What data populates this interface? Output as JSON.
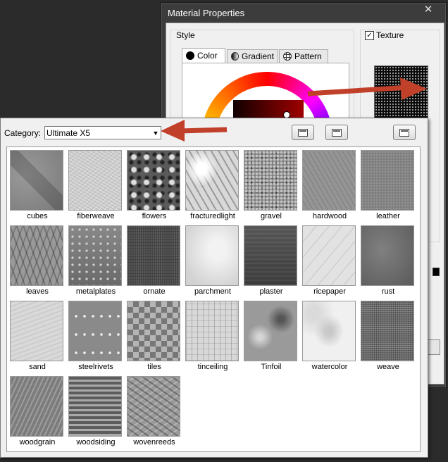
{
  "material_window": {
    "title": "Material Properties",
    "close_glyph": "✕",
    "style_group_label": "Style",
    "tabs": [
      {
        "label": "Color"
      },
      {
        "label": "Gradient"
      },
      {
        "label": "Pattern"
      }
    ],
    "texture_checkbox_label": "Texture",
    "texture_checked": true,
    "check_glyph": "✓"
  },
  "picker": {
    "category_label": "Category:",
    "category_value": "Ultimate X5",
    "dropdown_glyph": "▼"
  },
  "textures": [
    {
      "name": "cubes",
      "style": "t-cubes"
    },
    {
      "name": "fiberweave",
      "style": "t-fiberweave"
    },
    {
      "name": "flowers",
      "style": "t-flowers"
    },
    {
      "name": "fracturedlight",
      "style": "t-fracturedlight"
    },
    {
      "name": "gravel",
      "style": "t-gravel"
    },
    {
      "name": "hardwood",
      "style": "t-hardwood"
    },
    {
      "name": "leather",
      "style": "t-leather"
    },
    {
      "name": "leaves",
      "style": "t-leaves"
    },
    {
      "name": "metalplates",
      "style": "t-metalplates"
    },
    {
      "name": "ornate",
      "style": "t-ornate"
    },
    {
      "name": "parchment",
      "style": "t-parchment"
    },
    {
      "name": "plaster",
      "style": "t-plaster"
    },
    {
      "name": "ricepaper",
      "style": "t-ricepaper"
    },
    {
      "name": "rust",
      "style": "t-rust"
    },
    {
      "name": "sand",
      "style": "t-sand"
    },
    {
      "name": "steelrivets",
      "style": "t-steelrivets"
    },
    {
      "name": "tiles",
      "style": "t-tiles"
    },
    {
      "name": "tinceiling",
      "style": "t-tinceiling"
    },
    {
      "name": "Tinfoil",
      "style": "t-tinfoil"
    },
    {
      "name": "watercolor",
      "style": "t-watercolor"
    },
    {
      "name": "weave",
      "style": "t-weave"
    },
    {
      "name": "woodgrain",
      "style": "t-woodgrain"
    },
    {
      "name": "woodsiding",
      "style": "t-woodsiding"
    },
    {
      "name": "wovenreeds",
      "style": "t-wovenreeds"
    }
  ],
  "colors": {
    "arrow": "#c0402a",
    "background": "#2b2b2b",
    "window_chrome": "#3c3c3c",
    "dialog_face": "#f0f0f0"
  }
}
